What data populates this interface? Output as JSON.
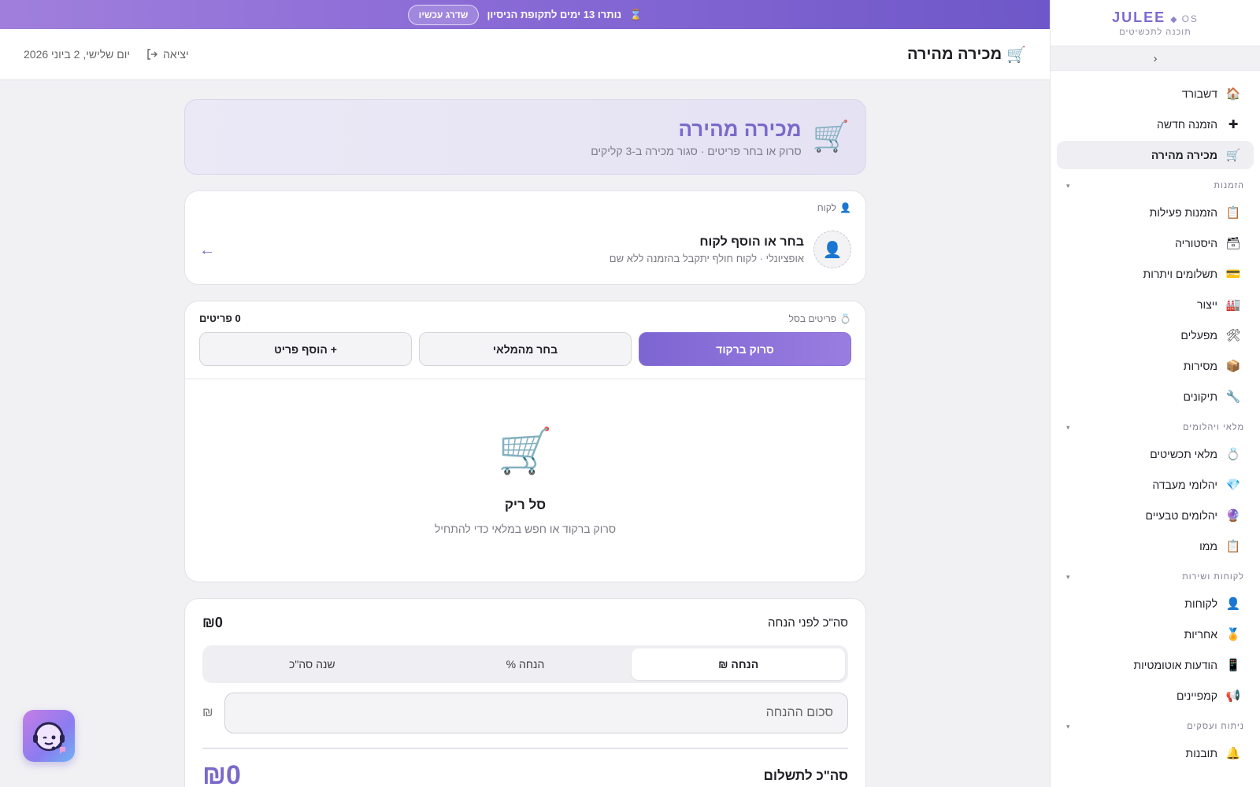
{
  "trial": {
    "icon": "hourglass-icon",
    "message": "נותרו 13 ימים לתקופת הניסיון",
    "upgrade_label": "שדרג עכשיו"
  },
  "topbar": {
    "title": "מכירה מהירה",
    "title_icon": "cart-icon",
    "logout_label": "יציאה",
    "date": "יום שלישי, 2 ביוני 2026"
  },
  "brand": {
    "name": "JULEE",
    "suffix": "OS",
    "tagline": "תוכנה לתכשיטים"
  },
  "sidebar": {
    "collapse_glyph": "‹",
    "sections": [
      {
        "label": "הזמנות"
      },
      {
        "label": "מלאי ויהלומים"
      },
      {
        "label": "לקוחות ושירות"
      },
      {
        "label": "ניתוח ועסקים"
      }
    ],
    "items": [
      {
        "label": "דשבורד",
        "icon": "🏠"
      },
      {
        "label": "הזמנה חדשה",
        "icon": "✚"
      },
      {
        "label": "מכירה מהירה",
        "icon": "🛒"
      },
      {
        "label": "הזמנות פעילות",
        "icon": "📋"
      },
      {
        "label": "היסטוריה",
        "icon": "🗃"
      },
      {
        "label": "תשלומים ויתרות",
        "icon": "💳"
      },
      {
        "label": "ייצור",
        "icon": "🏭"
      },
      {
        "label": "מפעלים",
        "icon": "🛠"
      },
      {
        "label": "מסירות",
        "icon": "📦"
      },
      {
        "label": "תיקונים",
        "icon": "🔧"
      },
      {
        "label": "מלאי תכשיטים",
        "icon": "💍"
      },
      {
        "label": "יהלומי מעבדה",
        "icon": "💎"
      },
      {
        "label": "יהלומים טבעיים",
        "icon": "🔮"
      },
      {
        "label": "ממו",
        "icon": "📋"
      },
      {
        "label": "לקוחות",
        "icon": "👤"
      },
      {
        "label": "אחריות",
        "icon": "🏅"
      },
      {
        "label": "הודעות אוטומטיות",
        "icon": "📱"
      },
      {
        "label": "קמפיינים",
        "icon": "📢"
      },
      {
        "label": "תובנות",
        "icon": "🔔"
      }
    ]
  },
  "hero": {
    "title": "מכירה מהירה",
    "subtitle": "סרוק או בחר פריטים · סגור מכירה ב-3 קליקים"
  },
  "customer": {
    "section_label": "לקוח",
    "title": "בחר או הוסף לקוח",
    "subtitle": "אופציונלי · לקוח חולף יתקבל בהזמנה ללא שם"
  },
  "basket": {
    "section_label": "פריטים בסל",
    "items_count": "0 פריטים",
    "buttons": {
      "scan": "סרוק ברקוד",
      "pick": "בחר מהמלאי",
      "add": "+ הוסף פריט"
    },
    "empty_title": "סל ריק",
    "empty_sub": "סרוק ברקוד או חפש במלאי כדי להתחיל"
  },
  "totals": {
    "subtotal_label": "סה\"כ לפני הנחה",
    "subtotal_value": "₪0",
    "tabs": [
      "הנחה ₪",
      "הנחה %",
      "שנה סה\"כ"
    ],
    "active_tab": 0,
    "discount_placeholder": "סכום ההנחה",
    "currency": "₪",
    "total_label": "סה\"כ לתשלום",
    "total_value": "₪0"
  },
  "colors": {
    "accent": "#7b69c9",
    "trial_gradient_start": "#a07fdc",
    "trial_gradient_end": "#6e57c8"
  }
}
